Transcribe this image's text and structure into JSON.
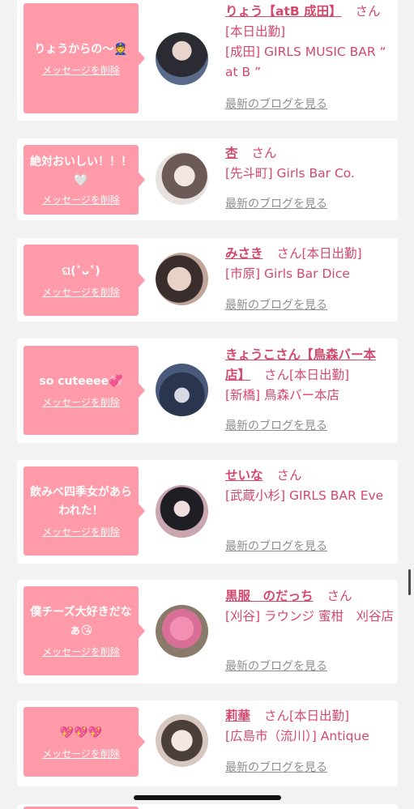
{
  "delete_label": "メッセージを削除",
  "blog_label": "最新のブログを見る",
  "san": "さん",
  "cards": [
    {
      "message": "りょうからの〜👮",
      "name": "りょう【atB 成田】",
      "status": "[本日出勤]",
      "shop": "[成田] GIRLS MUSIC BAR “ at B ”"
    },
    {
      "message": "絶対おいしい！！！🤍",
      "name": "杏",
      "status": "",
      "shop": "[先斗町] Girls Bar Co."
    },
    {
      "message": "ଘ(˃ᴗ˂)",
      "name": "みさき",
      "status": "[本日出勤]",
      "shop": "[市原] Girls Bar Dice"
    },
    {
      "message": "so cuteeee💞",
      "name": "きょうこさん【鳥森バー本店】",
      "status": "[本日出勤]",
      "shop": "[新橋] 鳥森バー本店"
    },
    {
      "message": "飲みべ四季女があらわれた！",
      "name": "せいな",
      "status": "",
      "shop": "[武蔵小杉] GIRLS BAR Eve"
    },
    {
      "message": "僕チーズ大好きだなぁ😘",
      "name": "黒服　のだっち",
      "status": "",
      "shop": "[刈谷] ラウンジ 蜜柑　刈谷店"
    },
    {
      "message": "💖💖💖",
      "name": "莉華",
      "status": "[本日出勤]",
      "shop": "[広島市（流川）] Antique"
    }
  ]
}
